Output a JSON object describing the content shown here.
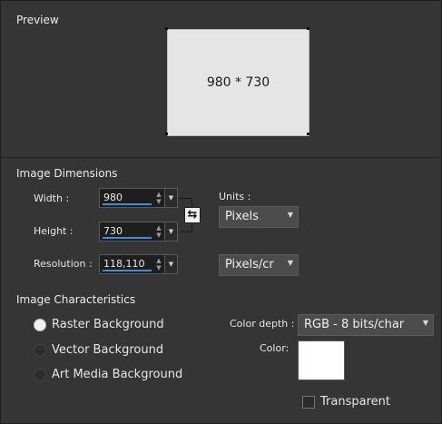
{
  "preview": {
    "title": "Preview",
    "size_text": "980 * 730"
  },
  "dimensions": {
    "title": "Image Dimensions",
    "width_label": "Width :",
    "width_value": "980",
    "height_label": "Height :",
    "height_value": "730",
    "resolution_label": "Resolution :",
    "resolution_value": "118,110",
    "units_label": "Units :",
    "units_value": "Pixels",
    "res_units_value": "Pixels/cr"
  },
  "characteristics": {
    "title": "Image Characteristics",
    "options": [
      {
        "label": "Raster Background",
        "selected": true
      },
      {
        "label": "Vector Background",
        "selected": false
      },
      {
        "label": "Art Media Background",
        "selected": false
      }
    ],
    "color_depth_label": "Color depth :",
    "color_depth_value": "RGB - 8 bits/char",
    "color_label": "Color:",
    "color_value": "#ffffff",
    "transparent_label": "Transparent",
    "transparent_checked": false
  },
  "icons": {
    "link": "link-chain-icon",
    "caret": "chevron-down-icon",
    "spin": "spinner-arrows-icon"
  }
}
